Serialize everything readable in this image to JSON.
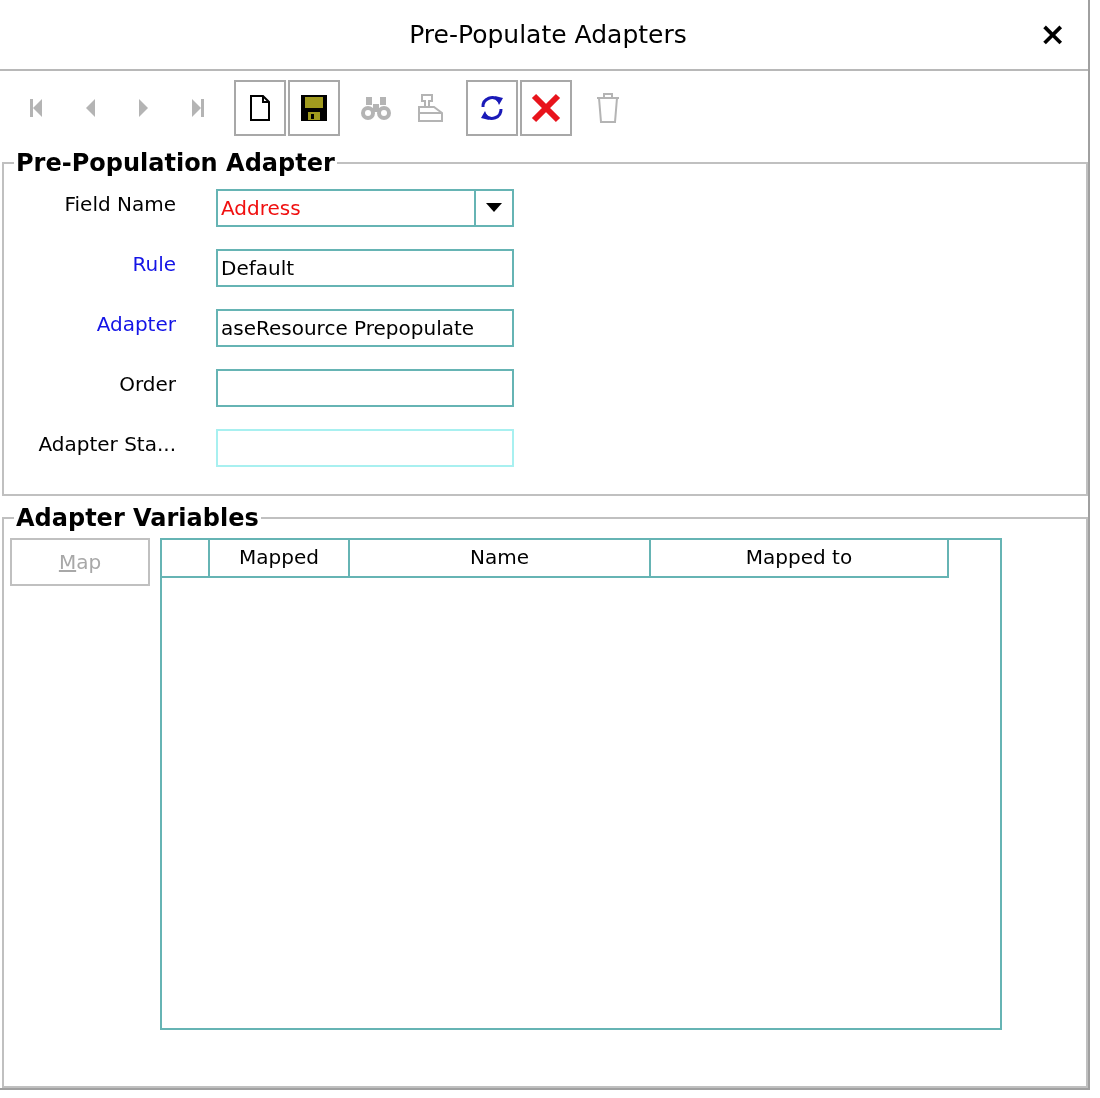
{
  "window": {
    "title": "Pre-Populate Adapters",
    "close": "×"
  },
  "toolbar": [
    {
      "kind": "first",
      "disabled": true
    },
    {
      "kind": "previous",
      "disabled": true
    },
    {
      "kind": "next",
      "disabled": true
    },
    {
      "kind": "last",
      "disabled": true
    },
    {
      "kind": "new",
      "disabled": false
    },
    {
      "kind": "save",
      "disabled": false
    },
    {
      "kind": "find",
      "disabled": true
    },
    {
      "kind": "clear",
      "disabled": true
    },
    {
      "kind": "refresh",
      "disabled": false
    },
    {
      "kind": "cancel",
      "disabled": false
    },
    {
      "kind": "delete",
      "disabled": true
    }
  ],
  "adapter_section": {
    "title": "Pre-Population Adapter",
    "fields": [
      {
        "label": "Field Name",
        "linked": false,
        "kind": "dropdown",
        "value": "Address",
        "error": true,
        "disabled": false
      },
      {
        "label": "Rule",
        "linked": true,
        "kind": "text",
        "value": "Default",
        "error": false,
        "disabled": false
      },
      {
        "label": "Adapter",
        "linked": true,
        "kind": "text",
        "value": "aseResource Prepopulate",
        "error": false,
        "disabled": false
      },
      {
        "label": "Order",
        "linked": false,
        "kind": "text",
        "disabled": false
      },
      {
        "label": "Adapter Sta...",
        "linked": false,
        "kind": "text",
        "disabled": true
      }
    ]
  },
  "variables_section": {
    "title": "Adapter Variables",
    "map_button": {
      "label": "Map",
      "mnemonic_underlined": true,
      "disabled": true
    },
    "table": {
      "columns": [
        "Mapped",
        "Name",
        "Mapped to"
      ]
    }
  }
}
